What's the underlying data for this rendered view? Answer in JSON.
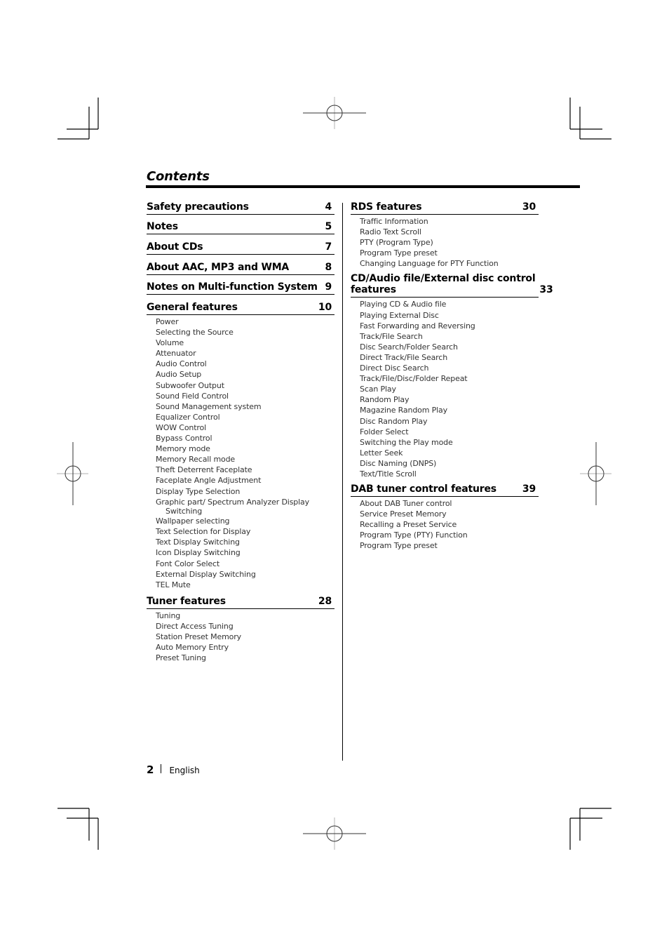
{
  "page": {
    "title": "Contents",
    "footer": {
      "page_number": "2",
      "language": "English"
    }
  },
  "left_column": [
    {
      "title": "Safety precautions",
      "page": "4",
      "items": []
    },
    {
      "title": "Notes",
      "page": "5",
      "items": []
    },
    {
      "title": "About CDs",
      "page": "7",
      "items": []
    },
    {
      "title": "About AAC, MP3 and WMA",
      "page": "8",
      "items": []
    },
    {
      "title": "Notes on Multi-function System",
      "page": "9",
      "items": []
    },
    {
      "title": "General features",
      "page": "10",
      "items": [
        "Power",
        "Selecting the Source",
        "Volume",
        "Attenuator",
        "Audio Control",
        "Audio Setup",
        "Subwoofer Output",
        "Sound Field Control",
        "Sound Management system",
        "Equalizer Control",
        "WOW Control",
        "Bypass Control",
        "Memory mode",
        "Memory Recall mode",
        "Theft Deterrent Faceplate",
        "Faceplate Angle Adjustment",
        "Display Type Selection",
        "Graphic part/ Spectrum Analyzer Display",
        "Switching",
        "Wallpaper selecting",
        "Text Selection for Display",
        "Text Display Switching",
        "Icon Display Switching",
        "Font Color Select",
        "External Display Switching",
        "TEL Mute"
      ]
    },
    {
      "title": "Tuner features",
      "page": "28",
      "items": [
        "Tuning",
        "Direct Access Tuning",
        "Station Preset Memory",
        "Auto Memory Entry",
        "Preset Tuning"
      ]
    }
  ],
  "right_column": [
    {
      "title": "RDS features",
      "page": "30",
      "items": [
        "Traffic Information",
        "Radio Text Scroll",
        "PTY (Program Type)",
        "Program Type preset",
        "Changing Language for PTY Function"
      ]
    },
    {
      "title_line1": "CD/Audio file/External disc control",
      "title_line2": "features",
      "page": "33",
      "items": [
        "Playing CD & Audio file",
        "Playing External Disc",
        "Fast Forwarding and Reversing",
        "Track/File Search",
        "Disc Search/Folder Search",
        "Direct Track/File Search",
        "Direct Disc Search",
        "Track/File/Disc/Folder Repeat",
        "Scan Play",
        "Random Play",
        "Magazine Random Play",
        "Disc Random Play",
        "Folder Select",
        "Switching the Play mode",
        "Letter Seek",
        "Disc Naming (DNPS)",
        "Text/Title Scroll"
      ]
    },
    {
      "title": "DAB tuner control features",
      "page": "39",
      "items": [
        "About DAB Tuner control",
        "Service Preset Memory",
        "Recalling a Preset Service",
        "Program Type (PTY) Function",
        "Program Type preset"
      ]
    }
  ]
}
